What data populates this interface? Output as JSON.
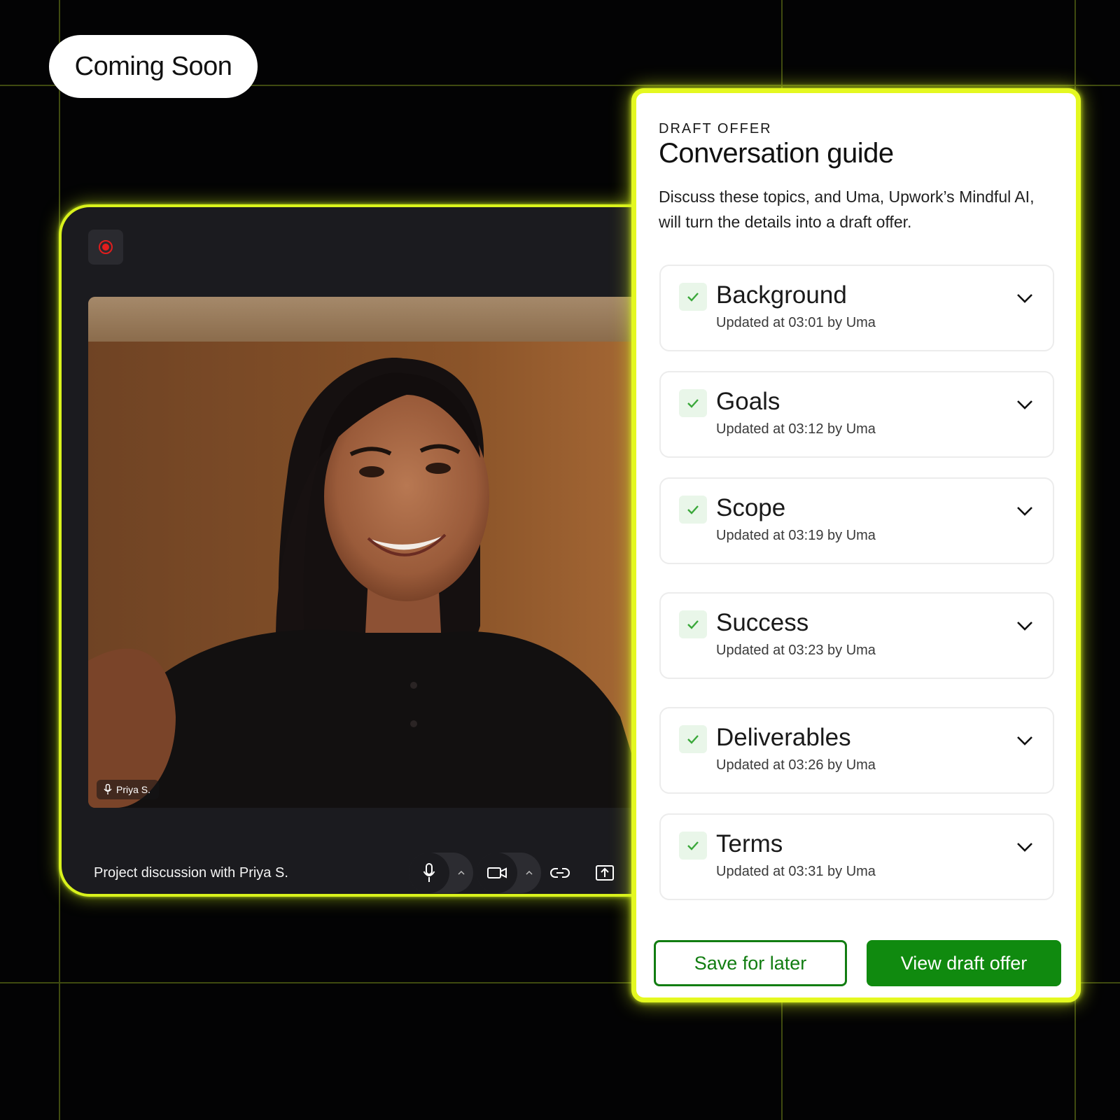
{
  "badge": {
    "label": "Coming Soon"
  },
  "call": {
    "participant_name": "Priya S.",
    "title": "Project discussion with Priya S.",
    "recording_icon": "record-icon",
    "controls": [
      "microphone-icon",
      "caret-up-icon",
      "camera-icon",
      "caret-up-icon",
      "link-icon",
      "share-screen-icon"
    ]
  },
  "guide": {
    "eyebrow": "DRAFT OFFER",
    "title": "Conversation guide",
    "description": "Discuss these topics, and Uma, Upwork’s Mindful AI, will turn the details into a draft offer.",
    "topics": [
      {
        "name": "Background",
        "meta": "Updated at 03:01 by Uma",
        "status": "checked"
      },
      {
        "name": "Goals",
        "meta": "Updated at 03:12 by Uma",
        "status": "checked"
      },
      {
        "name": "Scope",
        "meta": "Updated at 03:19 by Uma",
        "status": "checked"
      },
      {
        "name": "Success",
        "meta": "Updated at 03:23 by Uma",
        "status": "checked"
      },
      {
        "name": "Deliverables",
        "meta": "Updated at 03:26 by Uma",
        "status": "checked"
      },
      {
        "name": "Terms",
        "meta": "Updated at 03:31 by Uma",
        "status": "checked"
      }
    ],
    "save_label": "Save for later",
    "view_label": "View draft offer"
  },
  "colors": {
    "accent_glow": "#e4f820",
    "brand_green": "#108a0f",
    "record_red": "#e11d1d",
    "background": "#030304"
  }
}
